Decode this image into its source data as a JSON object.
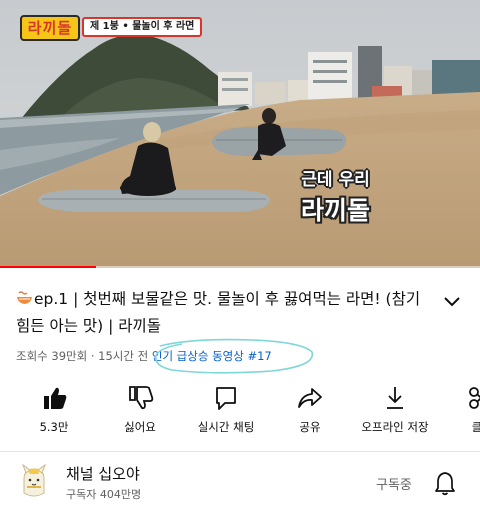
{
  "video": {
    "show_logo": "라끼돌",
    "episode_tag": "제 1붕 • 물놀이 후 라면",
    "caption_line1": "근데 우리",
    "caption_line2": "라끼돌",
    "progress_fraction": 0.2
  },
  "title": {
    "icon": "ramen-bowl-icon",
    "text": "ep.1 | 첫번째 보물같은 맛. 물놀이 후 끓여먹는 라면! (참기 힘든 아는 맛) | 라끼돌"
  },
  "meta": {
    "views": "조회수 39만회",
    "separator": "·",
    "time_ago": "15시간 전",
    "trending": "인기 급상승 동영상 #17"
  },
  "actions": [
    {
      "icon": "thumbs-up-icon",
      "label": "5.3만"
    },
    {
      "icon": "thumbs-down-icon",
      "label": "싫어요"
    },
    {
      "icon": "live-chat-icon",
      "label": "실시간 채팅"
    },
    {
      "icon": "share-icon",
      "label": "공유"
    },
    {
      "icon": "download-icon",
      "label": "오프라인 저장"
    },
    {
      "icon": "clip-icon",
      "label": "클"
    }
  ],
  "channel": {
    "name": "채널 십오야",
    "subscribers": "구독자 404만명",
    "subscribe_state": "구독중"
  },
  "colors": {
    "accent_red": "#ff0000",
    "link_blue": "#065fd4",
    "circle_mark": "#7fd6d8"
  }
}
